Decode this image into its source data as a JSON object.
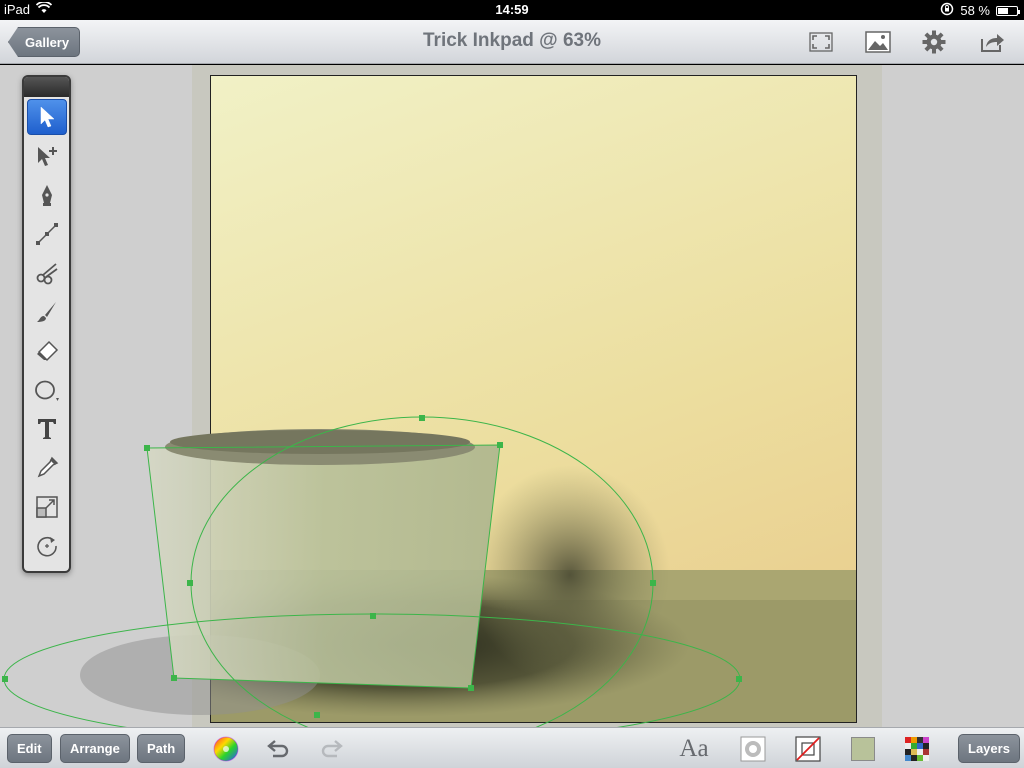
{
  "status_bar": {
    "device": "iPad",
    "time": "14:59",
    "battery": "58 %",
    "battery_level": 0.58
  },
  "nav_bar": {
    "back_label": "Gallery",
    "title": "Trick Inkpad @ 63%",
    "icons": [
      "fullscreen-icon",
      "image-icon",
      "gear-icon",
      "share-icon"
    ]
  },
  "toolbox": {
    "tools": [
      {
        "name": "select-tool",
        "selected": true
      },
      {
        "name": "subselect-tool",
        "selected": false
      },
      {
        "name": "pen-tool",
        "selected": false
      },
      {
        "name": "add-anchor-tool",
        "selected": false
      },
      {
        "name": "scissors-tool",
        "selected": false
      },
      {
        "name": "brush-tool",
        "selected": false
      },
      {
        "name": "eraser-tool",
        "selected": false
      },
      {
        "name": "ellipse-tool",
        "selected": false
      },
      {
        "name": "text-tool",
        "selected": false
      },
      {
        "name": "eyedropper-tool",
        "selected": false
      },
      {
        "name": "scale-tool",
        "selected": false
      },
      {
        "name": "rotate-tool",
        "selected": false
      }
    ]
  },
  "bottom_bar": {
    "edit_label": "Edit",
    "arrange_label": "Arrange",
    "path_label": "Path",
    "font_label": "Aa",
    "layers_label": "Layers",
    "fill_color": "#b8c29a"
  },
  "colors": {
    "accent": "#1f5fcd",
    "selection": "#3cb54a"
  }
}
